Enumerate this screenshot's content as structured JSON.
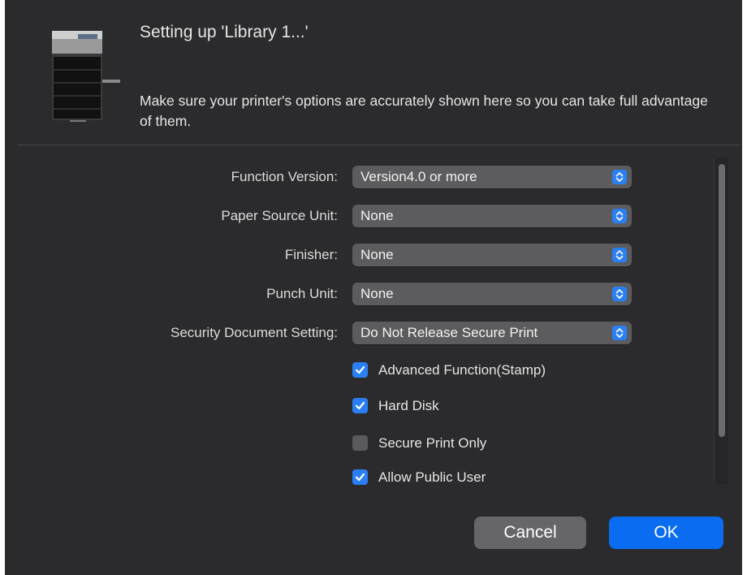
{
  "dialog": {
    "title": "Setting up 'Library 1...'",
    "description": "Make sure your printer's options are accurately shown here so you can take full advantage of them."
  },
  "options": [
    {
      "label": "Function Version:",
      "value": "Version4.0 or more"
    },
    {
      "label": "Paper Source Unit:",
      "value": "None"
    },
    {
      "label": "Finisher:",
      "value": "None"
    },
    {
      "label": "Punch Unit:",
      "value": "None"
    },
    {
      "label": "Security Document Setting:",
      "value": "Do Not Release Secure Print"
    }
  ],
  "checkboxes": [
    {
      "label": "Advanced Function(Stamp)",
      "checked": true
    },
    {
      "label": "Hard Disk",
      "checked": true
    },
    {
      "label": "Secure Print Only",
      "checked": false
    },
    {
      "label": "Allow Public User",
      "checked": true
    }
  ],
  "buttons": {
    "cancel": "Cancel",
    "ok": "OK"
  },
  "colors": {
    "background": "#2b2b2d",
    "accent": "#0a6cf0",
    "popup": "#5c5c5e",
    "secondary_button": "#66666a"
  }
}
